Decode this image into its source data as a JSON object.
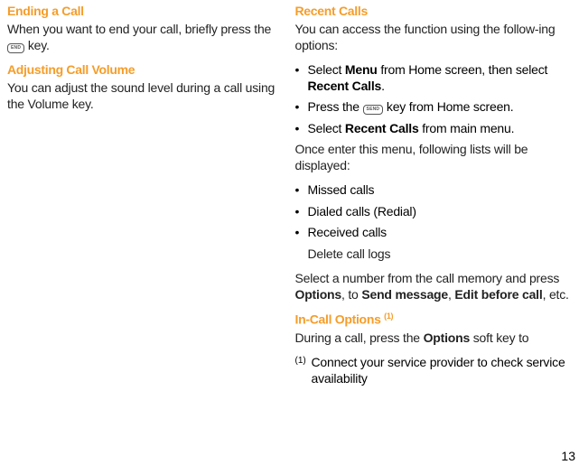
{
  "left": {
    "h1": "Ending a Call",
    "p1a": "When you want to end your call, briefly press the ",
    "key1": "END",
    "p1b": " key.",
    "h2": "Adjusting Call Volume",
    "p2": "You can adjust the sound level during a call using the Volume key."
  },
  "right": {
    "h1": "Recent Calls",
    "p1": "You can access the function using the follow-ing options:",
    "b1a": "Select ",
    "b1b": "Menu",
    "b1c": " from Home screen, then select ",
    "b1d": "Recent Calls",
    "b1e": ".",
    "b2a": "Press the ",
    "key2": "SEND",
    "b2b": " key from Home screen.",
    "b3a": "Select ",
    "b3b": "Recent Calls",
    "b3c": " from main menu.",
    "p2": "Once enter this menu, following lists will be displayed:",
    "b4": "Missed calls",
    "b5": "Dialed calls (Redial)",
    "b6": "Received calls",
    "b7": "Delete call logs",
    "p3a": "Select a number from the call memory and press ",
    "p3b": "Options",
    "p3c": ", to ",
    "p3d": "Send message",
    "p3e": ", ",
    "p3f": "Edit before call",
    "p3g": ", etc.",
    "h2": "In-Call Options ",
    "h2sup": "(1)",
    "p4a": "During a call, press the ",
    "p4b": "Options",
    "p4c": " soft key to",
    "fnmark": "(1)",
    "fntext": "Connect your service provider to check service availability"
  },
  "pagenum": "13"
}
